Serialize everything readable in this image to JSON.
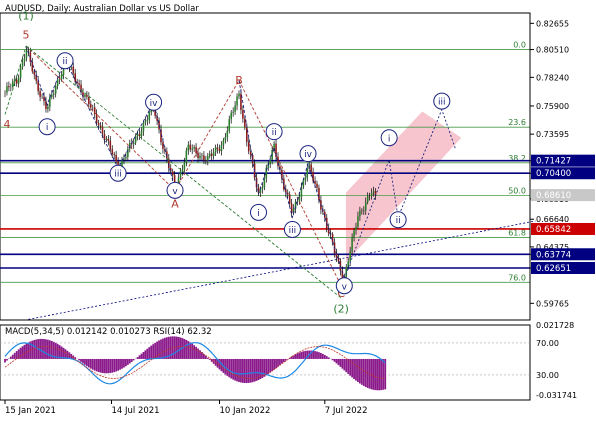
{
  "chart_data": {
    "type": "candlestick",
    "title": "AUDUSD, Daily:  Australian Dollar vs US Dollar",
    "price_axis": {
      "range": [
        0.584,
        0.835
      ],
      "ticks": [
        "0.82655",
        "0.80510",
        "0.78240",
        "0.75900",
        "0.73595",
        "0.71427",
        "0.70400",
        "0.68310",
        "0.66640",
        "0.64375",
        "0.63774",
        "0.62651",
        "0.59765"
      ]
    },
    "time_axis": {
      "labels": [
        {
          "t": 0,
          "text": "15 Jan 2021"
        },
        {
          "t": 0.273,
          "text": "14 Jul 2021"
        },
        {
          "t": 0.55,
          "text": "10 Jan 2022"
        },
        {
          "t": 0.82,
          "text": "7 Jul 2022"
        }
      ]
    },
    "fib_levels": [
      {
        "label": "0.0",
        "price": 0.8051
      },
      {
        "label": "23.6",
        "price": 0.74165
      },
      {
        "label": "38.2",
        "price": 0.7125
      },
      {
        "label": "50.0",
        "price": 0.6857
      },
      {
        "label": "61.8",
        "price": 0.6515
      },
      {
        "label": "76.0",
        "price": 0.6148
      }
    ],
    "horizontal_levels": [
      {
        "price": 0.71427,
        "label": "0.71427",
        "color": "#000080"
      },
      {
        "price": 0.704,
        "label": "0.70400",
        "color": "#000080"
      },
      {
        "price": 0.65842,
        "label": "0.65842",
        "color": "#cc0000"
      },
      {
        "price": 0.63774,
        "label": "0.63774",
        "color": "#000080"
      },
      {
        "price": 0.62651,
        "label": "0.62651",
        "color": "#000080"
      }
    ],
    "current_price_label": "0.68610",
    "wave_labels_major": [
      {
        "text": "(1)",
        "t": 0.054,
        "p": 0.8295,
        "color": "#2e7d32"
      },
      {
        "text": "5",
        "t": 0.054,
        "p": 0.814,
        "color": "#b03a2e"
      },
      {
        "text": "4",
        "t": 0.005,
        "p": 0.741,
        "color": "#b03a2e"
      },
      {
        "text": "B",
        "t": 0.6,
        "p": 0.777,
        "color": "#b03a2e"
      },
      {
        "text": "A",
        "t": 0.436,
        "p": 0.676,
        "color": "#b03a2e"
      },
      {
        "text": "C",
        "t": 0.862,
        "p": 0.603,
        "color": "#b03a2e"
      },
      {
        "text": "(2)",
        "t": 0.862,
        "p": 0.59,
        "color": "#2e7d32"
      }
    ],
    "wave_labels_minor": [
      {
        "text": "i",
        "t": 0.108,
        "p": 0.742
      },
      {
        "text": "ii",
        "t": 0.154,
        "p": 0.796
      },
      {
        "text": "iii",
        "t": 0.29,
        "p": 0.704
      },
      {
        "text": "iv",
        "t": 0.381,
        "p": 0.762
      },
      {
        "text": "v",
        "t": 0.436,
        "p": 0.69
      },
      {
        "text": "i",
        "t": 0.65,
        "p": 0.672
      },
      {
        "text": "ii",
        "t": 0.69,
        "p": 0.738
      },
      {
        "text": "iii",
        "t": 0.737,
        "p": 0.658
      },
      {
        "text": "iv",
        "t": 0.777,
        "p": 0.72
      },
      {
        "text": "v",
        "t": 0.87,
        "p": 0.612
      },
      {
        "text": "i",
        "t": 0.985,
        "p": 0.733
      },
      {
        "text": "ii",
        "t": 1.008,
        "p": 0.666
      },
      {
        "text": "iii",
        "t": 1.12,
        "p": 0.763
      }
    ],
    "projection_channel": {
      "points": [
        {
          "t": 0.874,
          "p": 0.688
        },
        {
          "t": 1.07,
          "p": 0.7545
        },
        {
          "t": 1.17,
          "p": 0.733
        },
        {
          "t": 0.874,
          "p": 0.631
        }
      ],
      "color": "#f4b6c2"
    },
    "indicator": {
      "label": "MACD(5,34,5) 0.012142 0.010273 RSI(14) 62.32",
      "axis_ticks": [
        "0.021728",
        "70.00",
        "30.00",
        "-0.031741"
      ]
    }
  }
}
